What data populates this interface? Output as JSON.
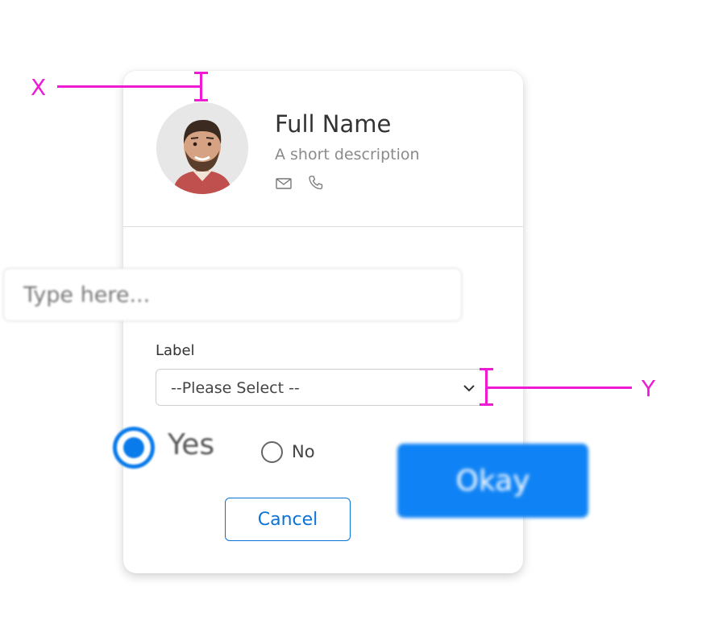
{
  "profile": {
    "name": "Full Name",
    "description": "A short description",
    "contact_icons": [
      "mail-icon",
      "phone-icon"
    ]
  },
  "text_input": {
    "placeholder": "Type here..."
  },
  "form": {
    "label": "Label",
    "select_value": "--Please Select --"
  },
  "radio": {
    "yes_label": "Yes",
    "no_label": "No",
    "selected": "Yes"
  },
  "buttons": {
    "cancel": "Cancel",
    "okay": "Okay"
  },
  "annotations": {
    "x_label": "X",
    "y_label": "Y"
  },
  "colors": {
    "accent": "#0a73d9",
    "okay_bg": "#0f83f5",
    "annotation": "#ee1ad4",
    "card_bg": "#ffffff"
  }
}
